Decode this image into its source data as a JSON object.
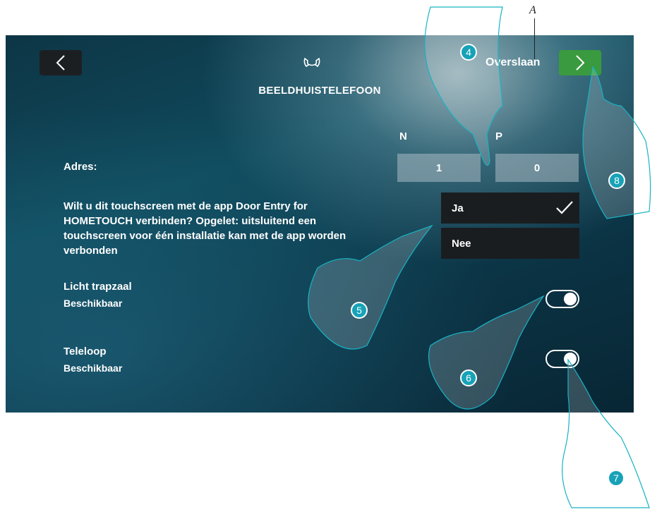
{
  "header": {
    "back_icon": "chevron-left-icon",
    "phone_icon": "handset-icon",
    "title": "BEELDHUISTELEFOON",
    "skip_label": "Overslaan",
    "next_icon": "chevron-right-icon",
    "annotation_letter": "A"
  },
  "address": {
    "label": "Adres:",
    "n_header": "N",
    "p_header": "P",
    "n_value": "1",
    "p_value": "0"
  },
  "app_connect": {
    "question": "Wilt u dit touchscreen met de app Door Entry for HOMETOUCH verbinden? Opgelet: uitsluitend een touchscreen voor één installatie kan met de app worden verbonden",
    "options": [
      {
        "label": "Ja",
        "selected": true
      },
      {
        "label": "Nee",
        "selected": false
      }
    ]
  },
  "settings": [
    {
      "title": "Licht trapzaal",
      "subtitle": "Beschikbaar",
      "enabled": true
    },
    {
      "title": "Teleloop",
      "subtitle": "Beschikbaar",
      "enabled": true
    }
  ],
  "callouts": [
    "4",
    "5",
    "6",
    "7",
    "8"
  ],
  "colors": {
    "next_button": "#3a9a3f",
    "callout": "#17a2b8",
    "screen_bg": "#0f4a5c"
  }
}
